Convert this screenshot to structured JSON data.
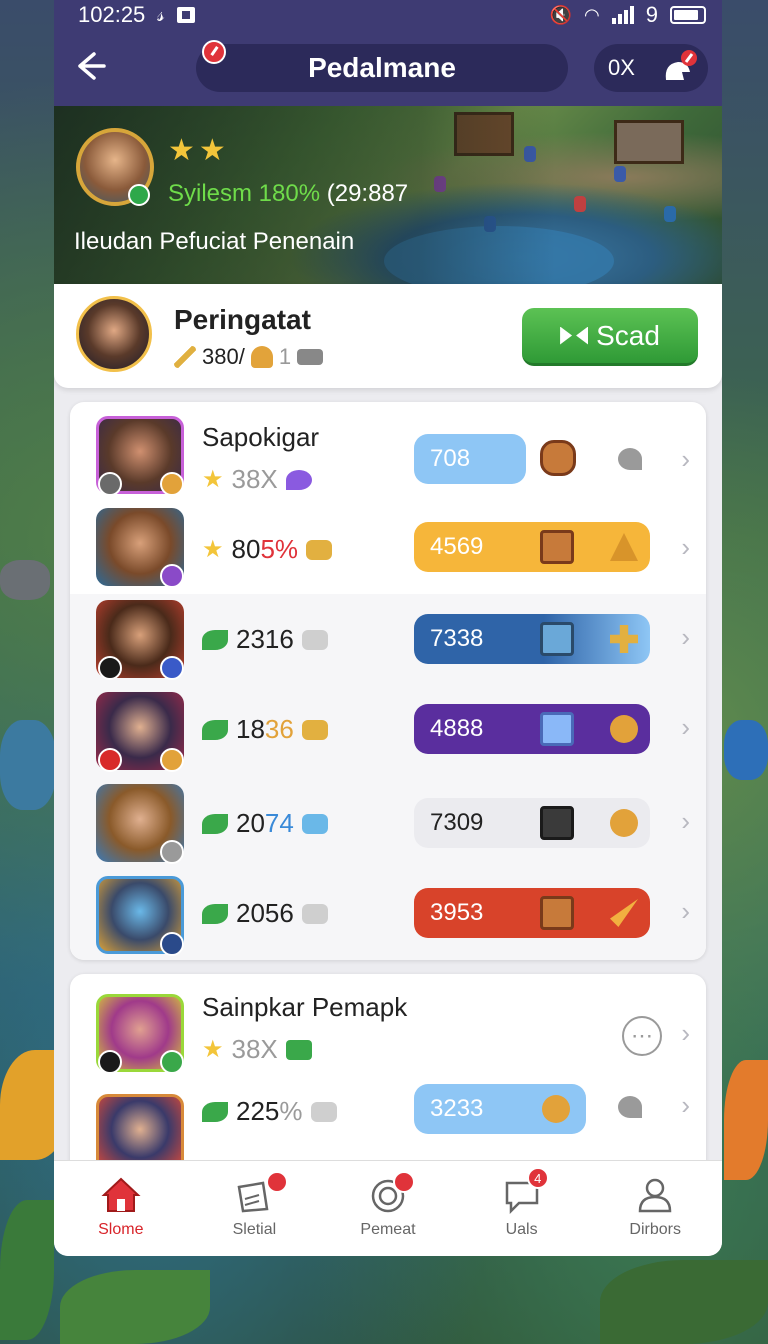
{
  "status_bar": {
    "time": "102:25",
    "battery_text": "9"
  },
  "header": {
    "title": "Pedalmane",
    "right_label": "0X"
  },
  "banner": {
    "stat_label": "Syilesm 180%",
    "stat_time": "(29:887",
    "subtitle": "Ileudan  Pefuciat Penenain"
  },
  "player": {
    "name": "Peringatat",
    "stat1": "380/",
    "stat2": "1",
    "button_label": "Scad"
  },
  "list1": [
    {
      "title": "Sapokigar",
      "sub": "38X",
      "sub_dim": true,
      "value": "708",
      "pill_color": "#8ec6f5"
    },
    {
      "sub_a": "80",
      "sub_b": "5%",
      "value": "4569",
      "pill_color": "#f6b63a"
    },
    {
      "sub_a": "2316",
      "sub_b": "",
      "value": "7338",
      "pill_color": "#2f64a8"
    },
    {
      "sub_a": "18",
      "sub_b": "36",
      "value": "4888",
      "pill_color": "#5a2e9e"
    },
    {
      "sub_a": "20",
      "sub_b": "74",
      "value": "7309",
      "pill_color": "#ebebef"
    },
    {
      "sub_a": "2056",
      "sub_b": "",
      "value": "3953",
      "pill_color": "#d8432a"
    }
  ],
  "list2": [
    {
      "title": "Sainpkar Pemapk",
      "sub": "38X"
    },
    {
      "sub_a": "225",
      "sub_b": "%",
      "value": "3233",
      "pill_color": "#8ec6f5"
    }
  ],
  "nav": [
    {
      "label": "Slome",
      "badge": ""
    },
    {
      "label": "Sletial",
      "badge": ""
    },
    {
      "label": "Pemeat",
      "badge": ""
    },
    {
      "label": "Uals",
      "badge": "4"
    },
    {
      "label": "Dirbors",
      "badge": ""
    }
  ],
  "colors": {
    "header_bg": "#3e3b73",
    "accent_red": "#d8242a",
    "button_green": "#3aaa3e"
  },
  "icons": [
    "back-arrow-icon",
    "ox-helmet-icon",
    "star-icon",
    "bow-icon",
    "chevron-right-icon",
    "more-icon",
    "home-icon",
    "social-icon",
    "target-icon",
    "chat-icon",
    "person-icon"
  ]
}
